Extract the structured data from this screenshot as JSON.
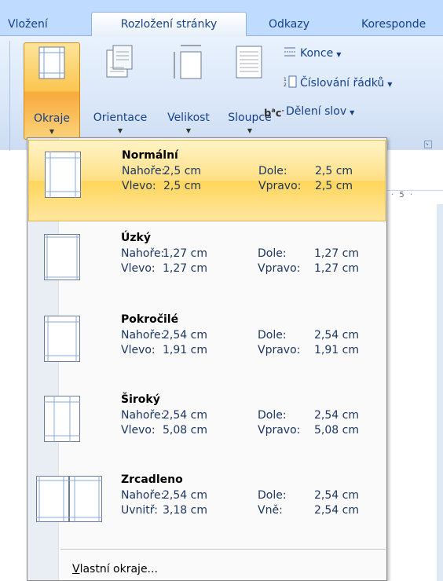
{
  "tabs": [
    {
      "label": "Vložení"
    },
    {
      "label": "Rozložení stránky",
      "active": true
    },
    {
      "label": "Odkazy"
    },
    {
      "label": "Koresponde"
    }
  ],
  "ribbon": {
    "buttons": [
      {
        "label": "Okraje",
        "icon": "margins-icon",
        "active": true
      },
      {
        "label": "Orientace",
        "icon": "orientation-icon"
      },
      {
        "label": "Velikost",
        "icon": "size-icon"
      },
      {
        "label": "Sloupce",
        "icon": "columns-icon"
      }
    ],
    "small_buttons": [
      {
        "label": "Konce",
        "icon": "breaks-icon"
      },
      {
        "label": "Číslování řádků",
        "icon": "line-numbers-icon"
      },
      {
        "label": "Dělení slov",
        "icon": "hyphenation-icon"
      }
    ],
    "ruler_text": "5"
  },
  "menu": {
    "items": [
      {
        "title": "Normální",
        "label1": "Nahoře:",
        "value1": "2,5 cm",
        "label2": "Dole:",
        "value2": "2,5 cm",
        "label3": "Vlevo:",
        "value3": "2,5 cm",
        "label4": "Vpravo:",
        "value4": "2,5 cm",
        "highlighted": true
      },
      {
        "title": "Úzký",
        "label1": "Nahoře:",
        "value1": "1,27 cm",
        "label2": "Dole:",
        "value2": "1,27 cm",
        "label3": "Vlevo:",
        "value3": "1,27 cm",
        "label4": "Vpravo:",
        "value4": "1,27 cm"
      },
      {
        "title": "Pokročilé",
        "label1": "Nahoře:",
        "value1": "2,54 cm",
        "label2": "Dole:",
        "value2": "2,54 cm",
        "label3": "Vlevo:",
        "value3": "1,91 cm",
        "label4": "Vpravo:",
        "value4": "1,91 cm"
      },
      {
        "title": "Široký",
        "label1": "Nahoře:",
        "value1": "2,54 cm",
        "label2": "Dole:",
        "value2": "2,54 cm",
        "label3": "Vlevo:",
        "value3": "5,08 cm",
        "label4": "Vpravo:",
        "value4": "5,08 cm"
      },
      {
        "title": "Zrcadleno",
        "label1": "Nahoře:",
        "value1": "2,54 cm",
        "label2": "Dole:",
        "value2": "2,54 cm",
        "label3": "Uvnitř:",
        "value3": "3,18 cm",
        "label4": "Vně:",
        "value4": "2,54 cm"
      }
    ],
    "custom_access_key": "V",
    "custom_rest": "lastní okraje..."
  },
  "colors": {
    "tab_text": "#15428b",
    "ribbon_bg": "#dbe8f9",
    "highlight": "#ffd55a"
  }
}
